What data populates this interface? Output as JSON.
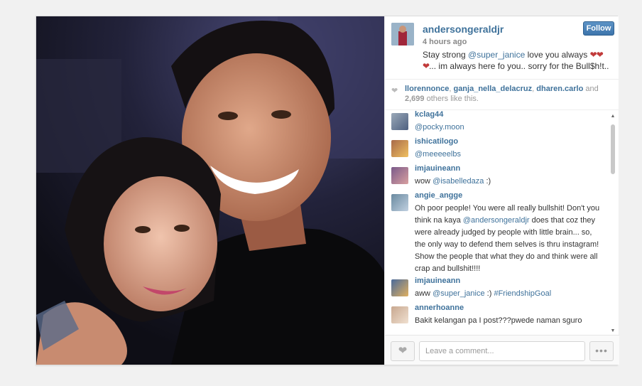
{
  "post": {
    "owner": "andersongeraldjr",
    "time": "4 hours ago",
    "follow_label": "Follow",
    "caption": {
      "pre": "Stay strong ",
      "mention": "@super_janice",
      "mid": " love you always ",
      "hearts": "❤❤❤",
      "post": "... im always here fo you.. sorry for the Bull$h!t.."
    }
  },
  "likes": {
    "likers": [
      "llorennonce",
      "ganja_nella_delacruz",
      "dharen.carlo"
    ],
    "and": "and",
    "count": "2,699",
    "suffix": "others like this."
  },
  "comments": [
    {
      "user": "kclag44",
      "parts": [
        {
          "t": "@pocky.moon",
          "m": true
        }
      ]
    },
    {
      "user": "ishicatilogo",
      "parts": [
        {
          "t": "@meeeeelbs",
          "m": true
        }
      ]
    },
    {
      "user": "imjauineann",
      "parts": [
        {
          "t": "wow ",
          "m": false
        },
        {
          "t": "@isabelledaza",
          "m": true
        },
        {
          "t": " :)",
          "m": false
        }
      ]
    },
    {
      "user": "angie_angge",
      "parts": [
        {
          "t": "Oh poor people! You were all really bullshit! Don't you think na kaya ",
          "m": false
        },
        {
          "t": "@andersongeraldjr",
          "m": true
        },
        {
          "t": " does that coz they were already judged by people with little brain... so, the only way to defend them selves is thru instagram! Show the people that what they do and think were all crap and bullshit!!!!",
          "m": false
        }
      ]
    },
    {
      "user": "imjauineann",
      "parts": [
        {
          "t": "aww ",
          "m": false
        },
        {
          "t": "@super_janice",
          "m": true
        },
        {
          "t": " :) ",
          "m": false
        },
        {
          "t": "#FriendshipGoal",
          "m": true
        }
      ]
    },
    {
      "user": "annerhoanne",
      "parts": [
        {
          "t": "Bakit kelangan pa I post???pwede naman sguro",
          "m": false
        }
      ]
    }
  ],
  "footer": {
    "comment_placeholder": "Leave a comment...",
    "more_label": "•••"
  },
  "icons": {
    "like": "heart-icon",
    "more": "more-options-icon",
    "scroll_up": "scroll-up-arrow",
    "scroll_down": "scroll-down-arrow"
  },
  "colors": {
    "link": "#3f729b",
    "follow_button": "#3d75ac",
    "heart_red": "#c13a3a"
  }
}
